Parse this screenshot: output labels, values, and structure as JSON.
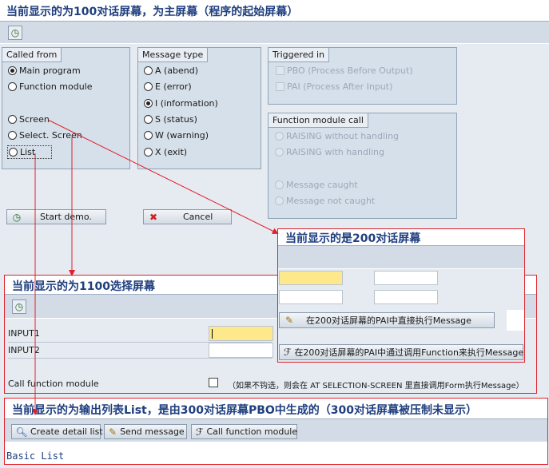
{
  "screen100": {
    "title": "当前显示的为100对话屏幕，为主屏幕（程序的起始屏幕）",
    "toolbar_icon": "execute-clock-icon",
    "called_from": {
      "label": "Called from",
      "options": [
        {
          "label": "Main program",
          "selected": true
        },
        {
          "label": "Function module",
          "selected": false
        },
        {
          "label": "Screen",
          "selected": false
        },
        {
          "label": "Select. Screen",
          "selected": false
        },
        {
          "label": "List",
          "selected": false
        }
      ]
    },
    "message_type": {
      "label": "Message type",
      "options": [
        {
          "label": "A (abend)",
          "selected": false
        },
        {
          "label": "E (error)",
          "selected": false
        },
        {
          "label": "I (information)",
          "selected": true
        },
        {
          "label": "S (status)",
          "selected": false
        },
        {
          "label": "W (warning)",
          "selected": false
        },
        {
          "label": "X (exit)",
          "selected": false
        }
      ]
    },
    "triggered_in": {
      "label": "Triggered in",
      "options": [
        {
          "label": "PBO (Process Before Output)",
          "checked": false
        },
        {
          "label": "PAI (Process After Input)",
          "checked": false
        }
      ]
    },
    "fm_call": {
      "label": "Function module call",
      "options": [
        {
          "label": "RAISING without handling"
        },
        {
          "label": "RAISING with handling"
        },
        {
          "label": "Message caught"
        },
        {
          "label": "Message not caught"
        }
      ]
    },
    "start_button": "Start demo.",
    "cancel_button": "Cancel"
  },
  "screen200": {
    "title": "当前显示的是200对话屏幕",
    "button1": "在200对话屏幕的PAI中直接执行Message",
    "button2": "在200对话屏幕的PAI中通过调用Function来执行Message"
  },
  "screen1100": {
    "title": "当前显示的为1100选择屏幕",
    "input1_label": "INPUT1",
    "input2_label": "INPUT2",
    "input1_value": "",
    "input2_value": "",
    "call_fm_label": "Call function module",
    "call_fm_note": "（如果不钩选，则会在 AT SELECTION-SCREEN 里直接调用Form执行Message）"
  },
  "list": {
    "title": "当前显示的为输出列表List，是由300对话屏幕PBO中生成的（300对话屏幕被压制未显示）",
    "buttons": [
      "Create detail list",
      "Send message",
      "Call function module"
    ],
    "content": "Basic List"
  },
  "colors": {
    "arrow": "#e0202a",
    "title": "#1f3f7f",
    "highlight": "#fde98c"
  }
}
